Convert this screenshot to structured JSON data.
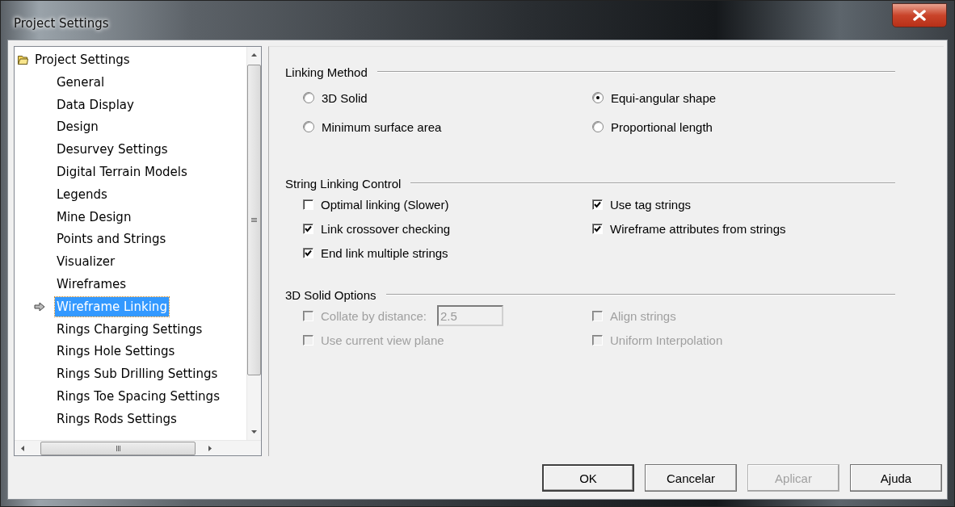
{
  "window": {
    "title": "Project Settings"
  },
  "tree": {
    "label": "Project Settings",
    "children": [
      {
        "label": "General",
        "selected": false
      },
      {
        "label": "Data Display",
        "selected": false
      },
      {
        "label": "Design",
        "selected": false
      },
      {
        "label": "Desurvey Settings",
        "selected": false
      },
      {
        "label": "Digital Terrain Models",
        "selected": false
      },
      {
        "label": "Legends",
        "selected": false
      },
      {
        "label": "Mine Design",
        "selected": false
      },
      {
        "label": "Points and Strings",
        "selected": false
      },
      {
        "label": "Visualizer",
        "selected": false
      },
      {
        "label": "Wireframes",
        "selected": false
      },
      {
        "label": "Wireframe Linking",
        "selected": true
      },
      {
        "label": "Rings Charging Settings",
        "selected": false
      },
      {
        "label": "Rings Hole Settings",
        "selected": false
      },
      {
        "label": "Rings Sub Drilling Settings",
        "selected": false
      },
      {
        "label": "Rings Toe Spacing Settings",
        "selected": false
      },
      {
        "label": "Rings Rods Settings",
        "selected": false
      }
    ]
  },
  "sections": [
    {
      "title": "Linking Method",
      "options": [
        {
          "kind": "radio",
          "label": "3D Solid",
          "selected": false,
          "disabled": false
        },
        {
          "kind": "radio",
          "label": "Equi-angular shape",
          "selected": true,
          "disabled": false
        },
        {
          "kind": "radio",
          "label": "Minimum surface area",
          "selected": false,
          "disabled": false
        },
        {
          "kind": "radio",
          "label": "Proportional length",
          "selected": false,
          "disabled": false
        }
      ]
    },
    {
      "title": "String Linking Control",
      "options": [
        {
          "kind": "checkbox",
          "label": "Optimal linking (Slower)",
          "checked": false,
          "disabled": false
        },
        {
          "kind": "checkbox",
          "label": "Use tag strings",
          "checked": true,
          "disabled": false
        },
        {
          "kind": "checkbox",
          "label": "Link crossover checking",
          "checked": true,
          "disabled": false
        },
        {
          "kind": "checkbox",
          "label": "Wireframe attributes from strings",
          "checked": true,
          "disabled": false
        },
        {
          "kind": "checkbox",
          "label": "End link multiple strings",
          "checked": true,
          "disabled": false
        }
      ]
    },
    {
      "title": "3D Solid Options",
      "options": [
        {
          "kind": "checkbox_field",
          "label": "Collate by distance:",
          "checked": false,
          "disabled": true,
          "value": "2.5"
        },
        {
          "kind": "checkbox",
          "label": "Align strings",
          "checked": false,
          "disabled": true
        },
        {
          "kind": "checkbox",
          "label": "Use current view plane",
          "checked": false,
          "disabled": true
        },
        {
          "kind": "checkbox",
          "label": "Uniform Interpolation",
          "checked": false,
          "disabled": true
        }
      ]
    }
  ],
  "buttons": [
    {
      "label": "OK",
      "disabled": false,
      "default": true
    },
    {
      "label": "Cancelar",
      "disabled": false,
      "default": false
    },
    {
      "label": "Aplicar",
      "disabled": true,
      "default": false
    },
    {
      "label": "Ajuda",
      "disabled": false,
      "default": false
    }
  ]
}
